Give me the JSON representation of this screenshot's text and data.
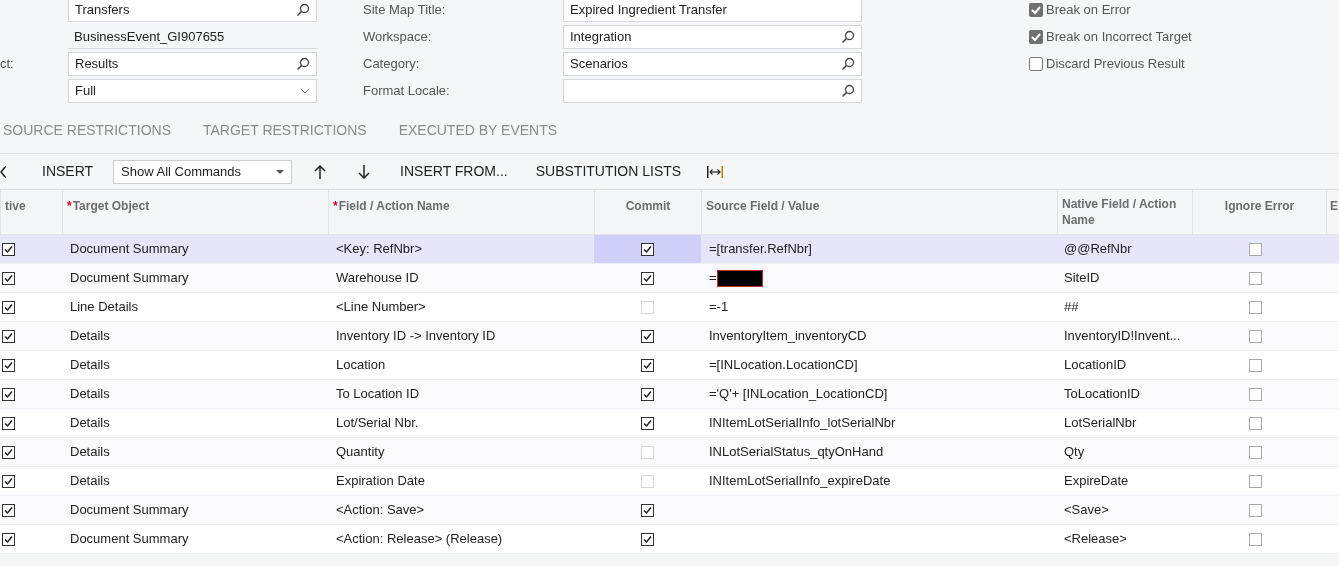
{
  "form": {
    "left_fields": [
      {
        "value": "Transfers",
        "kind": "lookup"
      },
      {
        "value": "BusinessEvent_GI907655",
        "kind": "readonly"
      },
      {
        "label": "ct:",
        "value": "Results",
        "kind": "lookup"
      },
      {
        "value": "Full",
        "kind": "dropdown"
      }
    ],
    "middle_fields": [
      {
        "label": "Site Map Title:",
        "value": "Expired Ingredient Transfer",
        "kind": "text"
      },
      {
        "label": "Workspace:",
        "value": "Integration",
        "kind": "lookup"
      },
      {
        "label": "Category:",
        "value": "Scenarios",
        "kind": "lookup"
      },
      {
        "label": "Format Locale:",
        "kind": "lookup"
      }
    ],
    "options": [
      {
        "label": "Break on Error",
        "checked": true
      },
      {
        "label": "Break on Incorrect Target",
        "checked": true
      },
      {
        "label": "Discard Previous Result",
        "checked": false
      }
    ]
  },
  "tabs": [
    {
      "label": "SOURCE RESTRICTIONS",
      "selected": false
    },
    {
      "label": "TARGET RESTRICTIONS",
      "selected": false
    },
    {
      "label": "EXECUTED BY EVENTS",
      "selected": false
    }
  ],
  "toolbar": [
    {
      "kind": "back"
    },
    {
      "kind": "text",
      "label": "INSERT"
    },
    {
      "kind": "dropdown",
      "label": "Show All Commands"
    },
    {
      "kind": "up"
    },
    {
      "kind": "down"
    },
    {
      "kind": "text",
      "label": "INSERT FROM..."
    },
    {
      "kind": "text",
      "label": "SUBSTITUTION LISTS"
    },
    {
      "kind": "fit"
    }
  ],
  "table": {
    "columns": [
      {
        "label": "tive"
      },
      {
        "label": "Target Object",
        "required_mark": "*"
      },
      {
        "label": "Field / Action Name",
        "required_mark": "*"
      },
      {
        "label": "Commit"
      },
      {
        "label": "Source Field / Value"
      },
      {
        "label": "Native Field / Action Name"
      },
      {
        "label": "Ignore Error"
      },
      {
        "label": "E"
      }
    ],
    "rows": [
      {
        "active": true,
        "target": "Document Summary",
        "field": "<Key: RefNbr>",
        "commit": true,
        "source": "=[transfer.RefNbr]",
        "native": "@@RefNbr",
        "ignore_error": false,
        "selected": true
      },
      {
        "active": true,
        "target": "Document Summary",
        "field": "Warehouse ID",
        "commit": true,
        "source": "=",
        "redacted": true,
        "native": "SiteID",
        "ignore_error": false,
        "selected": false
      },
      {
        "active": true,
        "target": "Line Details",
        "field": "<Line Number>",
        "commit": false,
        "source": "=-1",
        "native": "##",
        "ignore_error": false,
        "selected": false
      },
      {
        "active": true,
        "target": "Details",
        "field": "Inventory ID -> Inventory ID",
        "commit": true,
        "source": "InventoryItem_inventoryCD",
        "native": "InventoryID!Invent...",
        "ignore_error": false,
        "selected": false
      },
      {
        "active": true,
        "target": "Details",
        "field": "Location",
        "commit": true,
        "source": "=[INLocation.LocationCD]",
        "native": "LocationID",
        "ignore_error": false,
        "selected": false
      },
      {
        "active": true,
        "target": "Details",
        "field": "To Location ID",
        "commit": true,
        "source": "='Q'+ [INLocation_LocationCD]",
        "native": "ToLocationID",
        "ignore_error": false,
        "selected": false
      },
      {
        "active": true,
        "target": "Details",
        "field": "Lot/Serial Nbr.",
        "commit": true,
        "source": "INItemLotSerialInfo_lotSerialNbr",
        "native": "LotSerialNbr",
        "ignore_error": false,
        "selected": false
      },
      {
        "active": true,
        "target": "Details",
        "field": "Quantity",
        "commit": false,
        "source": "INLotSerialStatus_qtyOnHand",
        "native": "Qty",
        "ignore_error": false,
        "selected": false
      },
      {
        "active": true,
        "target": "Details",
        "field": "Expiration Date",
        "commit": false,
        "source": "INItemLotSerialInfo_expireDate",
        "native": "ExpireDate",
        "ignore_error": false,
        "selected": false
      },
      {
        "active": true,
        "target": "Document Summary",
        "field": "<Action: Save>",
        "commit": true,
        "native": "<Save>",
        "ignore_error": false,
        "selected": false
      },
      {
        "active": true,
        "target": "Document Summary",
        "field": "<Action: Release> (Release)",
        "commit": true,
        "native": "<Release>",
        "ignore_error": false,
        "selected": false
      }
    ]
  }
}
